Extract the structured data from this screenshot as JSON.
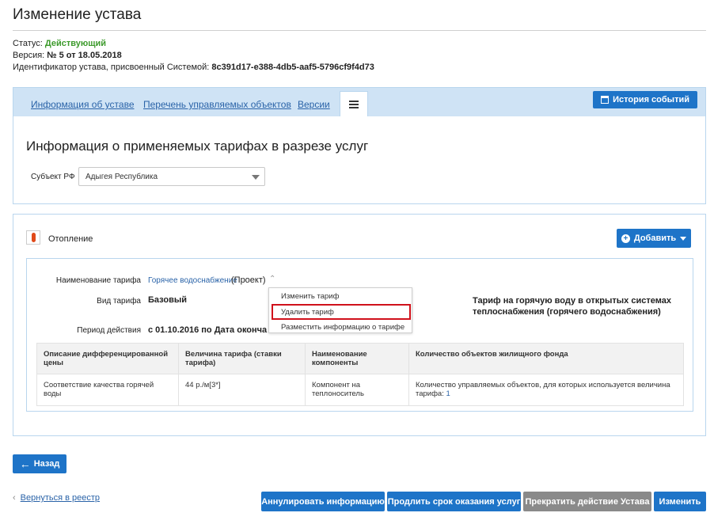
{
  "page": {
    "title": "Изменение устава",
    "status_label": "Статус:",
    "status_value": "Действующий",
    "version_label": "Версия:",
    "version_value": "№ 5 от 18.05.2018",
    "id_label": "Идентификатор устава, присвоенный Системой:",
    "id_value": "8c391d17-e388-4db5-aaf5-5796cf9f4d73"
  },
  "tabs": {
    "items": [
      "Информация об уставе",
      "Перечень управляемых объектов",
      "Версии"
    ],
    "history_button": "История событий"
  },
  "section": {
    "title": "Информация о применяемых тарифах в разрезе услуг",
    "subject_label": "Субъект РФ",
    "subject_value": "Адыгея Республика"
  },
  "heating": {
    "label": "Отопление",
    "add_button": "Добавить"
  },
  "tariff": {
    "name_label": "Наименование тарифа",
    "name_link": "Горячее водоснабжение",
    "name_status": "(Проект)",
    "type_label": "Вид тарифа",
    "type_value": "Базовый",
    "period_label": "Период действия",
    "period_value": "с 01.10.2016 по Дата оконча",
    "description": "Тариф на горячую воду в открытых системах теплоснабжения (горячего водоснабжения)"
  },
  "context_menu": {
    "items": [
      "Изменить тариф",
      "Удалить тариф",
      "Разместить информацию о тарифе"
    ],
    "highlighted_index": 1
  },
  "table": {
    "headers": [
      "Описание дифференцированной цены",
      "Величина тарифа (ставки тарифа)",
      "Наименование компоненты",
      "Количество объектов жилищного фонда"
    ],
    "row": {
      "description": "Соответствие качества горячей воды",
      "value": "44 р./м[3*]",
      "component": "Компонент на теплоноситель",
      "count_text": "Количество управляемых объектов, для которых используется величина тарифа:",
      "count_value": "1"
    }
  },
  "footer": {
    "back_button": "Назад",
    "registry_link": "Вернуться в реестр",
    "actions": [
      "Аннулировать информацию",
      "Продлить срок оказания услуг",
      "Прекратить действие Устава",
      "Изменить"
    ]
  },
  "colors": {
    "accent": "#1e74c8",
    "status_green": "#3c9a2b",
    "highlight_red": "#d0111b",
    "disabled_gray": "#8a8a8a"
  }
}
